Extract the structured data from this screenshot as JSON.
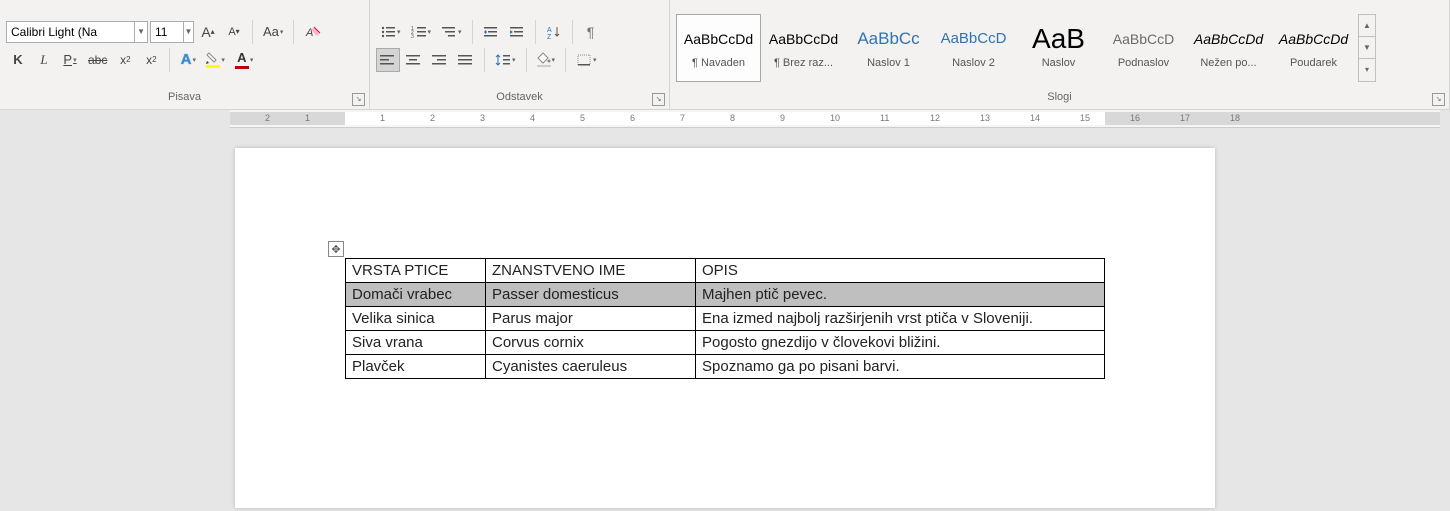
{
  "font": {
    "name": "Calibri Light (Na",
    "size": "11"
  },
  "group_labels": {
    "font": "Pisava",
    "paragraph": "Odstavek",
    "styles": "Slogi"
  },
  "styles": [
    {
      "sample": "AaBbCcDd",
      "label": "¶ Navaden",
      "sel": true,
      "color": "#000",
      "fs": 14
    },
    {
      "sample": "AaBbCcDd",
      "label": "¶ Brez raz...",
      "color": "#000",
      "fs": 14
    },
    {
      "sample": "AaBbCc",
      "label": "Naslov 1",
      "color": "#2e74b5",
      "fs": 17
    },
    {
      "sample": "AaBbCcD",
      "label": "Naslov 2",
      "color": "#2e74b5",
      "fs": 15
    },
    {
      "sample": "AaB",
      "label": "Naslov",
      "color": "#000",
      "fs": 28
    },
    {
      "sample": "AaBbCcD",
      "label": "Podnaslov",
      "color": "#6b6b6b",
      "fs": 14
    },
    {
      "sample": "AaBbCcDd",
      "label": "Nežen po...",
      "color": "#000",
      "fs": 14,
      "italic": true
    },
    {
      "sample": "AaBbCcDd",
      "label": "Poudarek",
      "color": "#000",
      "fs": 14,
      "italic": true
    }
  ],
  "ruler_ticks": [
    "2",
    "1",
    "1",
    "2",
    "3",
    "4",
    "5",
    "6",
    "7",
    "8",
    "9",
    "10",
    "11",
    "12",
    "13",
    "14",
    "15",
    "16",
    "17",
    "18"
  ],
  "table": {
    "header": [
      "VRSTA PTICE",
      "ZNANSTVENO IME",
      "OPIS"
    ],
    "rows": [
      [
        "Domači vrabec",
        "Passer domesticus",
        "Majhen ptič pevec."
      ],
      [
        "Velika sinica",
        "Parus major",
        "Ena izmed najbolj razširjenih vrst ptiča v Sloveniji."
      ],
      [
        "Siva vrana",
        "Corvus cornix",
        "Pogosto gnezdijo v človekovi bližini."
      ],
      [
        "Plavček",
        "Cyanistes caeruleus",
        "Spoznamo ga po pisani barvi."
      ]
    ],
    "selected_row": 0
  },
  "colors": {
    "highlight": "#ffff00",
    "font": "#c00000",
    "shading": "#ffffff",
    "border": "#7f7f7f",
    "textfx": "#3b8bd8"
  }
}
